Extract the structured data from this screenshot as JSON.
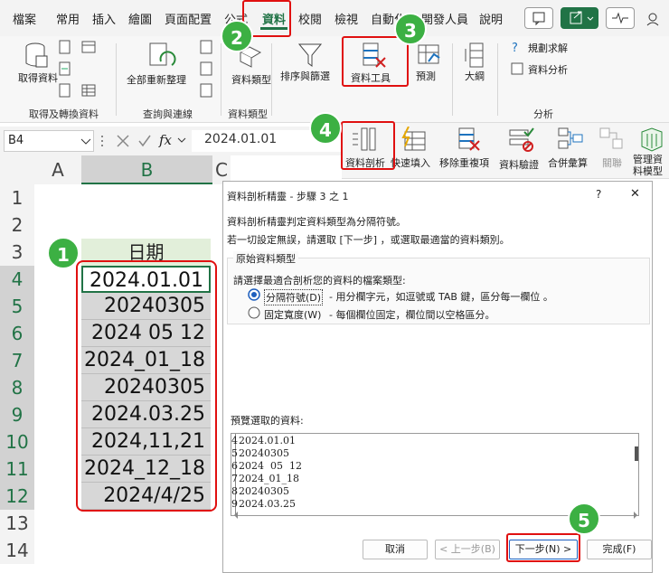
{
  "menu": {
    "tabs": [
      "檔案",
      "常用",
      "插入",
      "繪圖",
      "頁面配置",
      "公式",
      "資料",
      "校閱",
      "檢視",
      "自動化",
      "開發人員",
      "說明"
    ]
  },
  "ribbon": {
    "get_data": "取得資料",
    "get_data_suffix": "料",
    "refresh_all": "全部重新整理",
    "data_type": "資料類型",
    "sort_filter": "排序與篩選",
    "data_tools": "資料工具",
    "forecast": "預測",
    "outline": "大綱",
    "solver": "規劃求解",
    "data_analysis": "資料分析",
    "groups": {
      "get_transform": "取得及轉換資料",
      "queries": "查詢與連線",
      "data_types": "資料類型",
      "analysis": "分析"
    }
  },
  "subribbon": {
    "text_to_columns": "資料剖析",
    "flash_fill": "快速填入",
    "remove_duplicates": "移除重複項",
    "data_validation": "資料驗證",
    "consolidate": "合併彙算",
    "relationships": "關聯",
    "data_model": "管理資料模型"
  },
  "formula_bar": {
    "name_box": "B4",
    "value": "2024.01.01",
    "fx": "fx"
  },
  "sheet": {
    "columns": [
      "A",
      "B",
      "C"
    ],
    "rows": [
      "1",
      "2",
      "3",
      "4",
      "5",
      "6",
      "7",
      "8",
      "9",
      "10",
      "11",
      "12",
      "13",
      "14"
    ],
    "header_cell": "日期",
    "values": [
      "2024.01.01",
      "20240305",
      "2024 05 12",
      "2024_01_18",
      "20240305",
      "2024.03.25",
      "2024,11,21",
      "2024_12_18",
      "2024/4/25"
    ]
  },
  "dialog": {
    "title": "資料剖析精靈 - 步驟 3 之 1",
    "help": "?",
    "close": "✕",
    "line1": "資料剖析精靈判定資料類型為分隔符號。",
    "line2": "若一切設定無誤，請選取 [下一步] ，或選取最適當的資料類別。",
    "group_title": "原始資料類型",
    "prompt": "請選擇最適合剖析您的資料的檔案類型:",
    "option1": "分隔符號(D)",
    "option1_desc": "- 用分欄字元，如逗號或 TAB 鍵，區分每一欄位 。",
    "option2": "固定寬度(W)",
    "option2_desc": "- 每個欄位固定，欄位間以空格區分。",
    "preview_label": "預覽選取的資料:",
    "preview_rows": [
      {
        "n": "4",
        "v": "2024.01.01"
      },
      {
        "n": "5",
        "v": "20240305"
      },
      {
        "n": "6",
        "v": "2024  05  12"
      },
      {
        "n": "7",
        "v": "2024_01_18"
      },
      {
        "n": "8",
        "v": "20240305"
      },
      {
        "n": "9",
        "v": "2024.03.25"
      }
    ],
    "buttons": {
      "cancel": "取消",
      "back": "< 上一步(B)",
      "next": "下一步(N) >",
      "finish": "完成(F)"
    }
  },
  "callouts": [
    "1",
    "2",
    "3",
    "4",
    "5"
  ],
  "colors": {
    "accent_red": "#e01010",
    "callout_green": "#3cb043",
    "excel_green": "#217346"
  }
}
